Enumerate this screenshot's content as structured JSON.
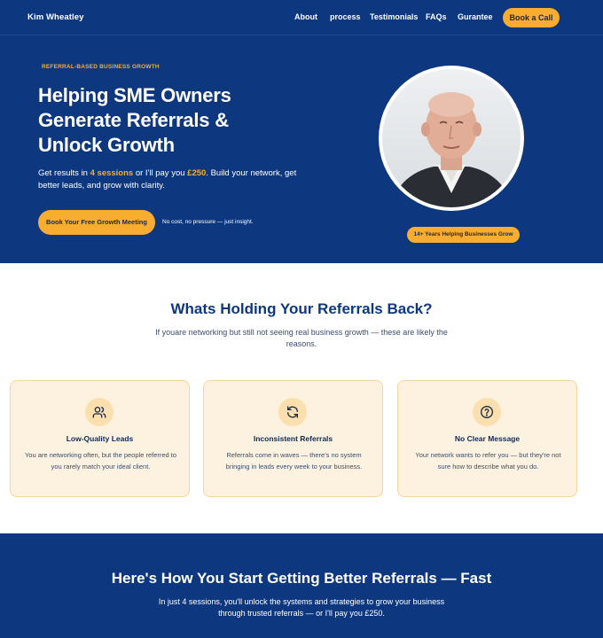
{
  "nav": {
    "brand": "Kim Wheatley",
    "links": [
      "About",
      "process",
      "Testimonials",
      "FAQs",
      "Gurantee"
    ],
    "cta": "Book a Call"
  },
  "hero": {
    "eyebrow": "REFERRAL-BASED BUSINESS GROWTH",
    "title_line1": "Helping SME Owners",
    "title_line2": "Generate Referrals &",
    "title_line3": "Unlock Growth",
    "text_a": "Get results in ",
    "text_sessions": "4 sessions",
    "text_b": " or I'll pay you ",
    "text_amount": "£250",
    "text_c": ". Build your network, get better leads, and grow with clarity.",
    "cta": "Book Your Free Growth Meeting",
    "note": "No cost, no pressure — just insight.",
    "badge": "14+ Years Helping Businesses Grow"
  },
  "problems": {
    "title": "Whats Holding Your Referrals Back?",
    "subtitle": "If youare networking but still not seeing real business growth — these are likely the reasons.",
    "cards": [
      {
        "title": "Low-Quality Leads",
        "text": "You are networking often, but the people referred to you rarely match your ideal client.",
        "icon": "users-icon"
      },
      {
        "title": "Inconsistent Referrals",
        "text": "Referrals come in waves — there's no system bringing in leads every week to your business.",
        "icon": "refresh-icon"
      },
      {
        "title": "No Clear Message",
        "text": "Your network wants to refer you — but they're not sure how to describe what you do.",
        "icon": "question-icon"
      }
    ]
  },
  "steps": {
    "title": "Here's How You Start Getting Better Referrals — Fast",
    "subtitle": "In just 4 sessions, you'll unlock the systems and strategies to grow your business through trusted referrals — or I'll pay you £250."
  },
  "colors": {
    "navy": "#0d3880",
    "accent": "#f8ad30",
    "card_bg": "#fdf1df"
  }
}
